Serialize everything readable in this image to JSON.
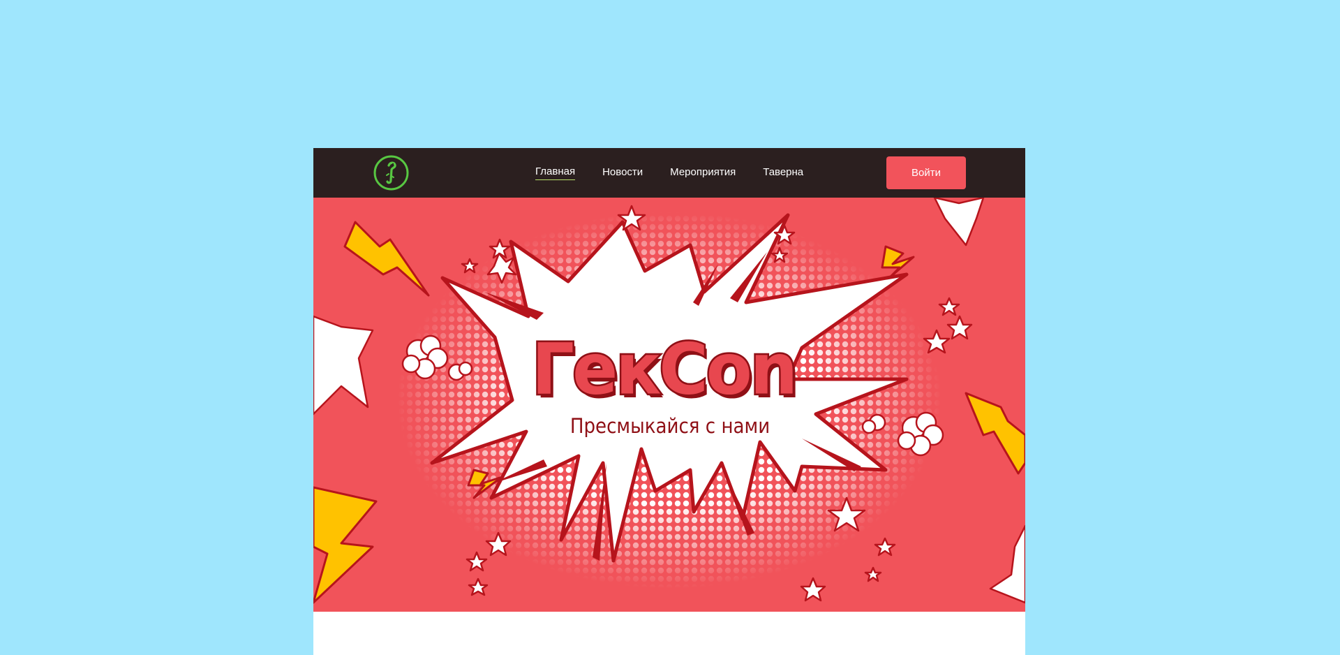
{
  "header": {
    "logo_icon": "lizard-in-circle-icon",
    "nav": [
      {
        "label": "Главная",
        "active": true
      },
      {
        "label": "Новости",
        "active": false
      },
      {
        "label": "Мероприятия",
        "active": false
      },
      {
        "label": "Таверна",
        "active": false
      }
    ],
    "login_label": "Войти"
  },
  "hero": {
    "title": "ГекCon",
    "subtitle": "Пресмыкайся с нами"
  },
  "colors": {
    "page_bg": "#9fe6fd",
    "navbar": "#2b1f1f",
    "accent": "#f2535b",
    "hero_bg": "#f1535a",
    "dark_red": "#8f1016",
    "lightning": "#ffc200",
    "logo_green": "#58c742"
  }
}
